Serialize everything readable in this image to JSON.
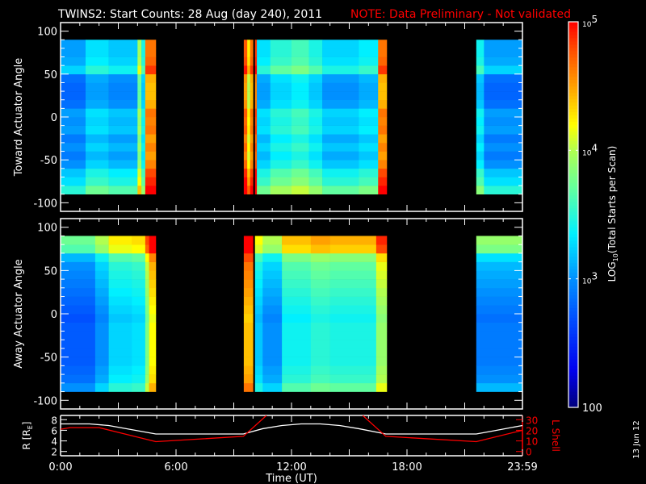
{
  "title": "TWINS2: Start Counts: 28 Aug (day 240), 2011",
  "note": "NOTE: Data Preliminary - Not validated",
  "date_stamp": "13 Jun 12",
  "colors": {
    "axis": "#ffffff",
    "note": "#ff0000",
    "r_line": "#ffffff",
    "lshell_line": "#ff0000",
    "background": "#000000"
  },
  "colorbar": {
    "label_main": "LOG",
    "label_sub": "10",
    "label_rest": "(Total Starts per Scan)",
    "range_log": [
      2,
      5
    ],
    "ticks": [
      {
        "log": 5,
        "base": "10",
        "exp": "5"
      },
      {
        "log": 4,
        "base": "10",
        "exp": "4"
      },
      {
        "log": 3,
        "base": "10",
        "exp": "3"
      },
      {
        "log": 2,
        "base": "100",
        "exp": ""
      }
    ],
    "stops": [
      [
        2.0,
        "#00007a"
      ],
      [
        2.3,
        "#0000f0"
      ],
      [
        2.7,
        "#0050ff"
      ],
      [
        3.0,
        "#0090ff"
      ],
      [
        3.35,
        "#00f0ff"
      ],
      [
        3.7,
        "#60ffa0"
      ],
      [
        4.0,
        "#b0ff50"
      ],
      [
        4.2,
        "#ffff00"
      ],
      [
        4.5,
        "#ffa000"
      ],
      [
        4.8,
        "#ff4800"
      ],
      [
        5.0,
        "#ff0000"
      ]
    ]
  },
  "x_axis": {
    "label": "Time (UT)",
    "range_hours": [
      0,
      24
    ],
    "tick_labels": [
      {
        "hour": 0,
        "label": "0:00"
      },
      {
        "hour": 6,
        "label": "6:00"
      },
      {
        "hour": 12,
        "label": "12:00"
      },
      {
        "hour": 18,
        "label": "18:00"
      },
      {
        "hour": 24,
        "label": "23:59"
      }
    ]
  },
  "chart_data": [
    {
      "type": "heatmap",
      "name": "toward",
      "ylabel": "Toward Actuator Angle",
      "ylim": [
        -110,
        110
      ],
      "yticks": [
        100,
        50,
        0,
        -50,
        -100
      ],
      "angle_bins_deg": [
        -90,
        90,
        10
      ],
      "angle_profile_log_offset": [
        0.5,
        0.3,
        0.2,
        0.0,
        -0.1,
        0.0,
        -0.1,
        0.05,
        0.0,
        0.05,
        -0.15,
        -0.2,
        -0.2,
        -0.15,
        0.25,
        0.1,
        0.05,
        0.05
      ],
      "columns_hours_baselog": [
        [
          0,
          1.3,
          3.0
        ],
        [
          1.3,
          2.5,
          3.25
        ],
        [
          2.5,
          4.0,
          3.15
        ],
        [
          4.0,
          4.2,
          3.9
        ],
        [
          4.2,
          4.4,
          3.4
        ],
        [
          4.4,
          4.95,
          4.6
        ],
        [
          9.52,
          9.7,
          4.7
        ],
        [
          9.7,
          9.85,
          4.2
        ],
        [
          9.85,
          10.0,
          4.6
        ],
        [
          10.1,
          10.2,
          4.8
        ],
        [
          10.2,
          10.9,
          3.25
        ],
        [
          10.9,
          12.0,
          3.45
        ],
        [
          12.0,
          12.9,
          3.55
        ],
        [
          12.9,
          13.6,
          3.4
        ],
        [
          13.6,
          15.5,
          3.2
        ],
        [
          15.5,
          16.5,
          3.3
        ],
        [
          16.5,
          16.95,
          4.6
        ],
        [
          21.6,
          22.0,
          3.35
        ],
        [
          22.0,
          24.0,
          3.0
        ]
      ]
    },
    {
      "type": "heatmap",
      "name": "away",
      "ylabel": "Away Actuator Angle",
      "ylim": [
        -110,
        110
      ],
      "yticks": [
        100,
        50,
        0,
        -50,
        -100
      ],
      "angle_bins_deg": [
        -90,
        90,
        10
      ],
      "angle_profile_log_offset": [
        0.15,
        0.0,
        -0.05,
        -0.1,
        -0.1,
        -0.1,
        -0.1,
        -0.1,
        -0.15,
        -0.1,
        -0.05,
        0.0,
        0.05,
        0.1,
        0.15,
        0.3,
        0.8,
        0.9
      ],
      "columns_hours_baselog": [
        [
          0,
          1.8,
          2.85
        ],
        [
          1.8,
          2.5,
          3.1
        ],
        [
          2.5,
          3.7,
          3.35
        ],
        [
          3.7,
          4.4,
          3.4
        ],
        [
          4.4,
          4.6,
          3.9
        ],
        [
          4.6,
          4.95,
          4.3
        ],
        [
          9.52,
          10.0,
          4.5
        ],
        [
          10.1,
          10.5,
          3.3
        ],
        [
          10.5,
          11.5,
          3.1
        ],
        [
          11.5,
          13.0,
          3.5
        ],
        [
          13.0,
          14.0,
          3.6
        ],
        [
          14.0,
          16.4,
          3.55
        ],
        [
          16.4,
          16.95,
          4.0
        ],
        [
          21.6,
          24.0,
          3.0
        ]
      ]
    },
    {
      "type": "line",
      "name": "orbit",
      "ylabel_left": "R [R",
      "ylabel_left_sub": "E",
      "ylabel_left_end": "]",
      "ylabel_right": "L Shell",
      "ylim_left": [
        1.2,
        8.8
      ],
      "ylim_right": [
        -4,
        34
      ],
      "yticks_left": [
        2,
        4,
        6,
        8
      ],
      "yticks_right": [
        0,
        10,
        20,
        30
      ],
      "series": [
        {
          "name": "R",
          "axis": "left",
          "points": [
            [
              0,
              7.2
            ],
            [
              1.5,
              7.2
            ],
            [
              2.5,
              6.9
            ],
            [
              4.95,
              5.3
            ],
            [
              9.5,
              5.3
            ],
            [
              10.5,
              6.3
            ],
            [
              11.5,
              6.9
            ],
            [
              12.5,
              7.2
            ],
            [
              13.5,
              7.2
            ],
            [
              14.5,
              6.9
            ],
            [
              15.5,
              6.3
            ],
            [
              16.9,
              5.3
            ],
            [
              21.6,
              5.3
            ],
            [
              22.5,
              5.9
            ],
            [
              24,
              6.9
            ]
          ]
        },
        {
          "name": "L Shell",
          "axis": "right",
          "points": [
            [
              0,
              21
            ],
            [
              0.5,
              22.5
            ],
            [
              2,
              22.5
            ],
            [
              3,
              18
            ],
            [
              4.95,
              9.3
            ],
            [
              9.5,
              14.3
            ],
            [
              10.7,
              34
            ]
          ]
        },
        {
          "name": "L Shell",
          "axis": "right",
          "points": [
            [
              15.7,
              34
            ],
            [
              16.9,
              14.3
            ],
            [
              21.6,
              9.3
            ],
            [
              24,
              20
            ]
          ]
        }
      ]
    }
  ]
}
